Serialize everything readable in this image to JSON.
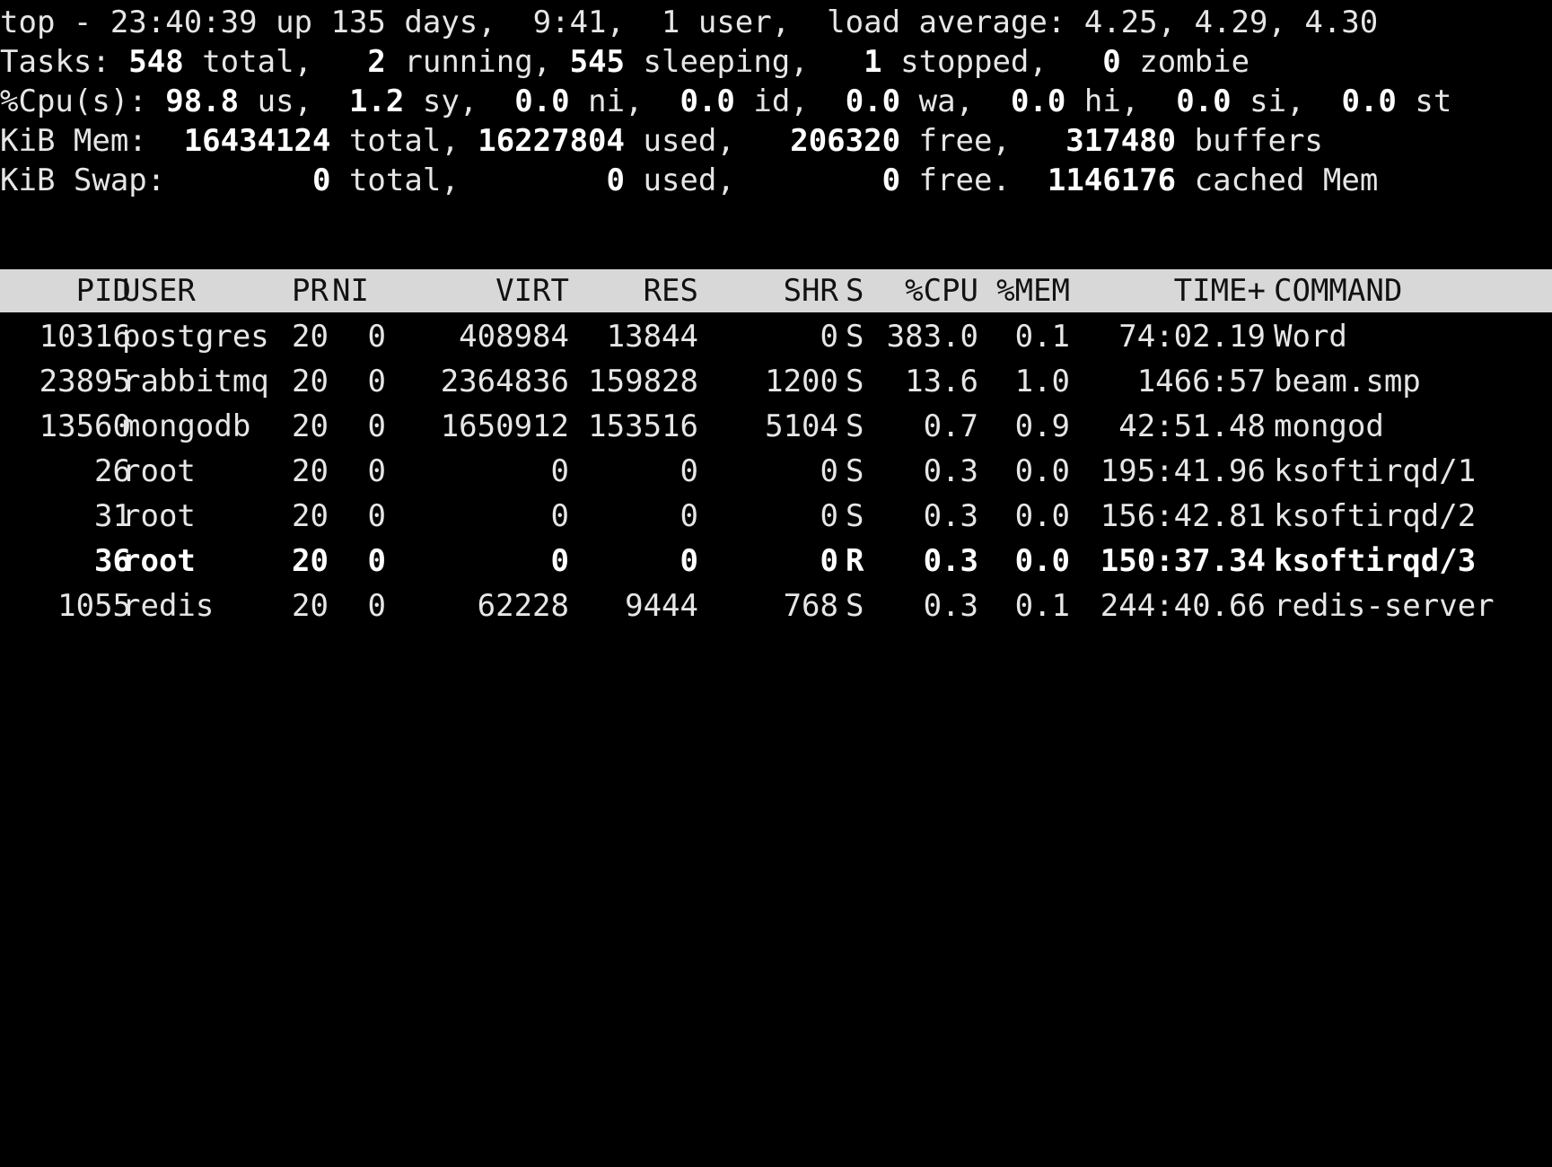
{
  "summary": {
    "top": {
      "prefix": "top - ",
      "time": "23:40:39",
      "uptime": " up 135 days,  9:41,  1 user,  load average: ",
      "load": "4.25, 4.29, 4.30"
    },
    "tasks": {
      "label": "Tasks: ",
      "total": "548",
      "total_label": " total,   ",
      "running": "2",
      "running_label": " running, ",
      "sleeping": "545",
      "sleeping_label": " sleeping,   ",
      "stopped": "1",
      "stopped_label": " stopped,   ",
      "zombie": "0",
      "zombie_label": " zombie"
    },
    "cpu": {
      "label": "%Cpu(s): ",
      "us": "98.8",
      "us_label": " us,  ",
      "sy": "1.2",
      "sy_label": " sy,  ",
      "ni": "0.0",
      "ni_label": " ni,  ",
      "id": "0.0",
      "id_label": " id,  ",
      "wa": "0.0",
      "wa_label": " wa,  ",
      "hi": "0.0",
      "hi_label": " hi,  ",
      "si": "0.0",
      "si_label": " si,  ",
      "st": "0.0",
      "st_label": " st"
    },
    "mem": {
      "label": "KiB Mem:  ",
      "total": "16434124",
      "total_label": " total, ",
      "used": "16227804",
      "used_label": " used,   ",
      "free": "206320",
      "free_label": " free,   ",
      "buffers": "317480",
      "buffers_label": " buffers"
    },
    "swap": {
      "label": "KiB Swap:        ",
      "total": "0",
      "total_label": " total,        ",
      "used": "0",
      "used_label": " used,        ",
      "free": "0",
      "free_label": " free.  ",
      "cached": "1146176",
      "cached_label": " cached Mem"
    }
  },
  "table": {
    "headers": {
      "pid": "PID",
      "user": "USER",
      "pr": "PR",
      "ni": "NI",
      "virt": "VIRT",
      "res": "RES",
      "shr": "SHR",
      "s": "S",
      "cpu": "%CPU",
      "mem": "%MEM",
      "time": "TIME+",
      "cmd": "COMMAND"
    },
    "rows": [
      {
        "pid": "10316",
        "user": "postgres",
        "pr": "20",
        "ni": "0",
        "virt": "408984",
        "res": "13844",
        "shr": "0",
        "s": "S",
        "cpu": "383.0",
        "mem": "0.1",
        "time": "74:02.19",
        "cmd": "Word"
      },
      {
        "pid": "23895",
        "user": "rabbitmq",
        "pr": "20",
        "ni": "0",
        "virt": "2364836",
        "res": "159828",
        "shr": "1200",
        "s": "S",
        "cpu": "13.6",
        "mem": "1.0",
        "time": "1466:57",
        "cmd": "beam.smp"
      },
      {
        "pid": "13560",
        "user": "mongodb",
        "pr": "20",
        "ni": "0",
        "virt": "1650912",
        "res": "153516",
        "shr": "5104",
        "s": "S",
        "cpu": "0.7",
        "mem": "0.9",
        "time": "42:51.48",
        "cmd": "mongod"
      },
      {
        "pid": "26",
        "user": "root",
        "pr": "20",
        "ni": "0",
        "virt": "0",
        "res": "0",
        "shr": "0",
        "s": "S",
        "cpu": "0.3",
        "mem": "0.0",
        "time": "195:41.96",
        "cmd": "ksoftirqd/1"
      },
      {
        "pid": "31",
        "user": "root",
        "pr": "20",
        "ni": "0",
        "virt": "0",
        "res": "0",
        "shr": "0",
        "s": "S",
        "cpu": "0.3",
        "mem": "0.0",
        "time": "156:42.81",
        "cmd": "ksoftirqd/2"
      },
      {
        "pid": "36",
        "user": "root",
        "pr": "20",
        "ni": "0",
        "virt": "0",
        "res": "0",
        "shr": "0",
        "s": "R",
        "cpu": "0.3",
        "mem": "0.0",
        "time": "150:37.34",
        "cmd": "ksoftirqd/3"
      },
      {
        "pid": "1055",
        "user": "redis",
        "pr": "20",
        "ni": "0",
        "virt": "62228",
        "res": "9444",
        "shr": "768",
        "s": "S",
        "cpu": "0.3",
        "mem": "0.1",
        "time": "244:40.66",
        "cmd": "redis-server"
      }
    ]
  }
}
